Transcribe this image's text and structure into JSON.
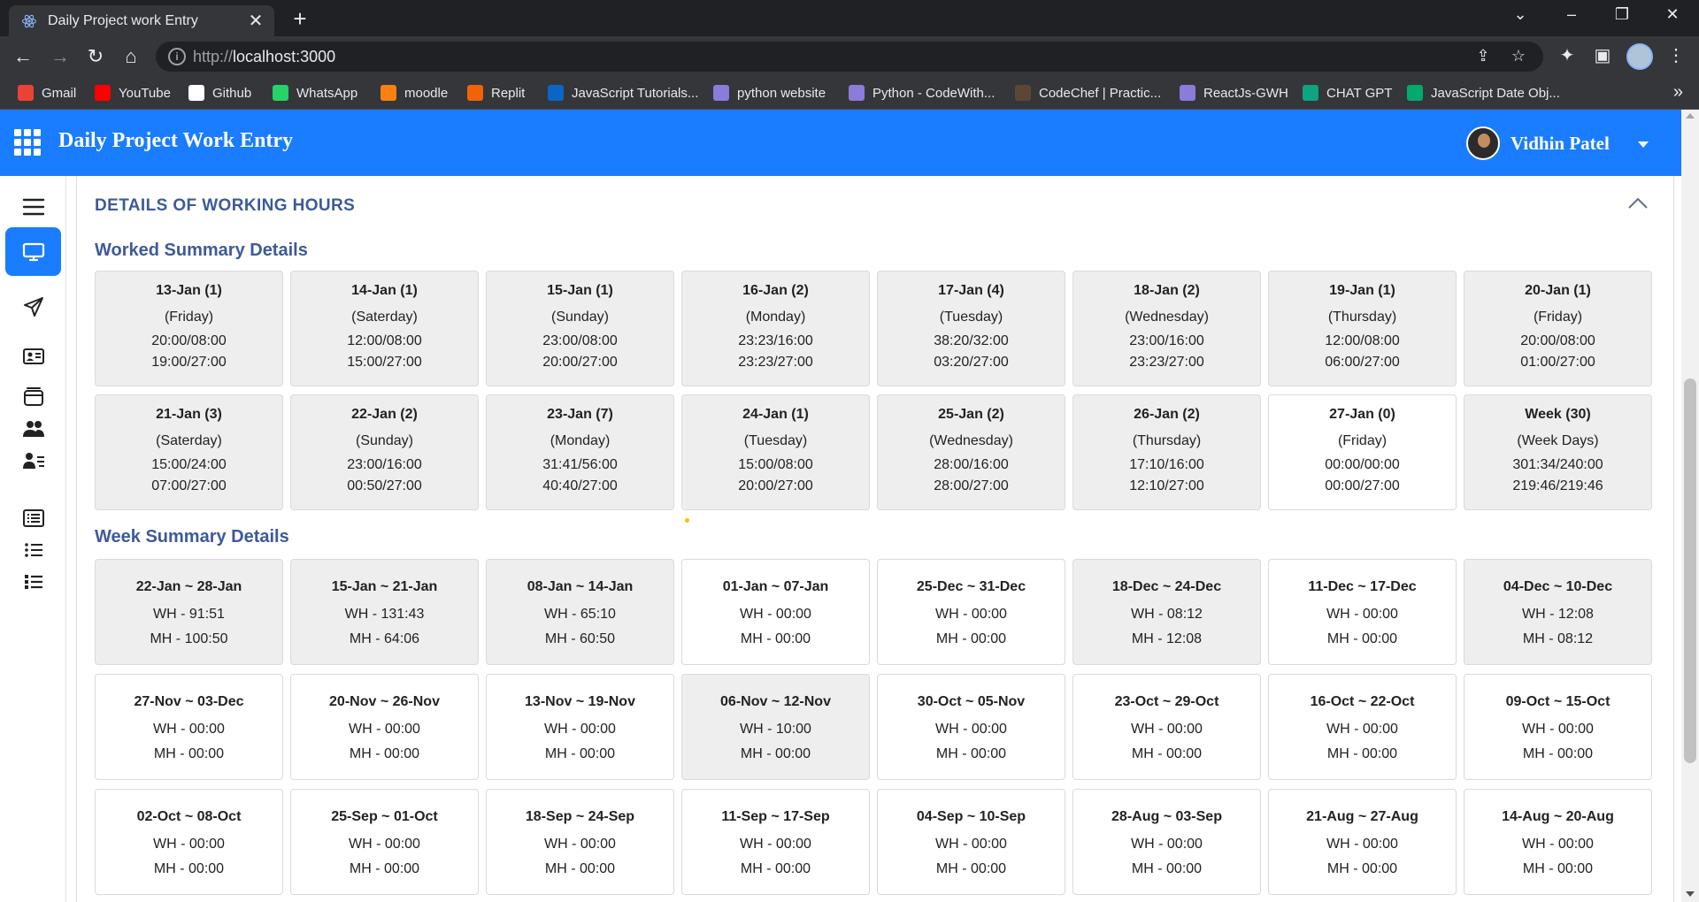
{
  "browser": {
    "tab_title": "Daily Project work Entry",
    "url_scheme": "http://",
    "url_host": "localhost:3000",
    "bookmarks": [
      {
        "label": "Gmail",
        "icon": "gmail-icon",
        "color": "#ea4335"
      },
      {
        "label": "YouTube",
        "icon": "youtube-icon",
        "color": "#ff0000"
      },
      {
        "label": "Github",
        "icon": "github-icon",
        "color": "#ffffff"
      },
      {
        "label": "WhatsApp",
        "icon": "whatsapp-icon",
        "color": "#25d366"
      },
      {
        "label": "moodle",
        "icon": "moodle-icon",
        "color": "#f98012"
      },
      {
        "label": "Replit",
        "icon": "replit-icon",
        "color": "#f26207"
      },
      {
        "label": "JavaScript Tutorials...",
        "icon": "linkedin-icon",
        "color": "#0a66c2"
      },
      {
        "label": "python website",
        "icon": "python-site-icon",
        "color": "#8a7cd8"
      },
      {
        "label": "Python - CodeWith...",
        "icon": "codewithharry-icon",
        "color": "#8a7cd8"
      },
      {
        "label": "CodeChef | Practic...",
        "icon": "codechef-icon",
        "color": "#5b4638"
      },
      {
        "label": "ReactJs-GWH",
        "icon": "reactjs-icon",
        "color": "#8a7cd8"
      },
      {
        "label": "CHAT GPT",
        "icon": "chatgpt-icon",
        "color": "#10a37f"
      },
      {
        "label": "JavaScript Date Obj...",
        "icon": "w3schools-icon",
        "color": "#04aa6d"
      }
    ]
  },
  "header": {
    "title": "Daily Project Work Entry",
    "user_name": "Vidhin Patel",
    "bg_color": "#1a7cff"
  },
  "section": {
    "title": "DETAILS OF WORKING HOURS",
    "worked_title": "Worked Summary Details",
    "week_title": "Week Summary Details"
  },
  "worked_days": [
    {
      "date": "13-Jan (1)",
      "day": "(Friday)",
      "a": "20:00/08:00",
      "b": "19:00/27:00",
      "style": "gray"
    },
    {
      "date": "14-Jan (1)",
      "day": "(Saterday)",
      "a": "12:00/08:00",
      "b": "15:00/27:00",
      "style": "gray"
    },
    {
      "date": "15-Jan (1)",
      "day": "(Sunday)",
      "a": "23:00/08:00",
      "b": "20:00/27:00",
      "style": "gray"
    },
    {
      "date": "16-Jan (2)",
      "day": "(Monday)",
      "a": "23:23/16:00",
      "b": "23:23/27:00",
      "style": "gray"
    },
    {
      "date": "17-Jan (4)",
      "day": "(Tuesday)",
      "a": "38:20/32:00",
      "b": "03:20/27:00",
      "style": "gray"
    },
    {
      "date": "18-Jan (2)",
      "day": "(Wednesday)",
      "a": "23:00/16:00",
      "b": "23:23/27:00",
      "style": "gray"
    },
    {
      "date": "19-Jan (1)",
      "day": "(Thursday)",
      "a": "12:00/08:00",
      "b": "06:00/27:00",
      "style": "gray"
    },
    {
      "date": "20-Jan (1)",
      "day": "(Friday)",
      "a": "20:00/08:00",
      "b": "01:00/27:00",
      "style": "gray"
    },
    {
      "date": "21-Jan (3)",
      "day": "(Saterday)",
      "a": "15:00/24:00",
      "b": "07:00/27:00",
      "style": "gray"
    },
    {
      "date": "22-Jan (2)",
      "day": "(Sunday)",
      "a": "23:00/16:00",
      "b": "00:50/27:00",
      "style": "gray"
    },
    {
      "date": "23-Jan (7)",
      "day": "(Monday)",
      "a": "31:41/56:00",
      "b": "40:40/27:00",
      "style": "gray"
    },
    {
      "date": "24-Jan (1)",
      "day": "(Tuesday)",
      "a": "15:00/08:00",
      "b": "20:00/27:00",
      "style": "gray"
    },
    {
      "date": "25-Jan (2)",
      "day": "(Wednesday)",
      "a": "28:00/16:00",
      "b": "28:00/27:00",
      "style": "gray"
    },
    {
      "date": "26-Jan (2)",
      "day": "(Thursday)",
      "a": "17:10/16:00",
      "b": "12:10/27:00",
      "style": "gray"
    },
    {
      "date": "27-Jan (0)",
      "day": "(Friday)",
      "a": "00:00/00:00",
      "b": "00:00/27:00",
      "style": "white"
    },
    {
      "date": "Week (30)",
      "day": "(Week Days)",
      "a": "301:34/240:00",
      "b": "219:46/219:46",
      "style": "gray"
    }
  ],
  "weeks": [
    {
      "range": "22-Jan ~ 28-Jan",
      "wh": "WH - 91:51",
      "mh": "MH - 100:50",
      "style": "gray"
    },
    {
      "range": "15-Jan ~ 21-Jan",
      "wh": "WH - 131:43",
      "mh": "MH - 64:06",
      "style": "gray"
    },
    {
      "range": "08-Jan ~ 14-Jan",
      "wh": "WH - 65:10",
      "mh": "MH - 60:50",
      "style": "gray"
    },
    {
      "range": "01-Jan ~ 07-Jan",
      "wh": "WH - 00:00",
      "mh": "MH - 00:00",
      "style": "white"
    },
    {
      "range": "25-Dec ~ 31-Dec",
      "wh": "WH - 00:00",
      "mh": "MH - 00:00",
      "style": "white"
    },
    {
      "range": "18-Dec ~ 24-Dec",
      "wh": "WH - 08:12",
      "mh": "MH - 12:08",
      "style": "gray"
    },
    {
      "range": "11-Dec ~ 17-Dec",
      "wh": "WH - 00:00",
      "mh": "MH - 00:00",
      "style": "white"
    },
    {
      "range": "04-Dec ~ 10-Dec",
      "wh": "WH - 12:08",
      "mh": "MH - 08:12",
      "style": "gray"
    },
    {
      "range": "27-Nov ~ 03-Dec",
      "wh": "WH - 00:00",
      "mh": "MH - 00:00",
      "style": "white"
    },
    {
      "range": "20-Nov ~ 26-Nov",
      "wh": "WH - 00:00",
      "mh": "MH - 00:00",
      "style": "white"
    },
    {
      "range": "13-Nov ~ 19-Nov",
      "wh": "WH - 00:00",
      "mh": "MH - 00:00",
      "style": "white"
    },
    {
      "range": "06-Nov ~ 12-Nov",
      "wh": "WH - 10:00",
      "mh": "MH - 00:00",
      "style": "gray"
    },
    {
      "range": "30-Oct ~ 05-Nov",
      "wh": "WH - 00:00",
      "mh": "MH - 00:00",
      "style": "white"
    },
    {
      "range": "23-Oct ~ 29-Oct",
      "wh": "WH - 00:00",
      "mh": "MH - 00:00",
      "style": "white"
    },
    {
      "range": "16-Oct ~ 22-Oct",
      "wh": "WH - 00:00",
      "mh": "MH - 00:00",
      "style": "white"
    },
    {
      "range": "09-Oct ~ 15-Oct",
      "wh": "WH - 00:00",
      "mh": "MH - 00:00",
      "style": "white"
    },
    {
      "range": "02-Oct ~ 08-Oct",
      "wh": "WH - 00:00",
      "mh": "MH - 00:00",
      "style": "white"
    },
    {
      "range": "25-Sep ~ 01-Oct",
      "wh": "WH - 00:00",
      "mh": "MH - 00:00",
      "style": "white"
    },
    {
      "range": "18-Sep ~ 24-Sep",
      "wh": "WH - 00:00",
      "mh": "MH - 00:00",
      "style": "white"
    },
    {
      "range": "11-Sep ~ 17-Sep",
      "wh": "WH - 00:00",
      "mh": "MH - 00:00",
      "style": "white"
    },
    {
      "range": "04-Sep ~ 10-Sep",
      "wh": "WH - 00:00",
      "mh": "MH - 00:00",
      "style": "white"
    },
    {
      "range": "28-Aug ~ 03-Sep",
      "wh": "WH - 00:00",
      "mh": "MH - 00:00",
      "style": "white"
    },
    {
      "range": "21-Aug ~ 27-Aug",
      "wh": "WH - 00:00",
      "mh": "MH - 00:00",
      "style": "white"
    },
    {
      "range": "14-Aug ~ 20-Aug",
      "wh": "WH - 00:00",
      "mh": "MH - 00:00",
      "style": "white"
    }
  ]
}
